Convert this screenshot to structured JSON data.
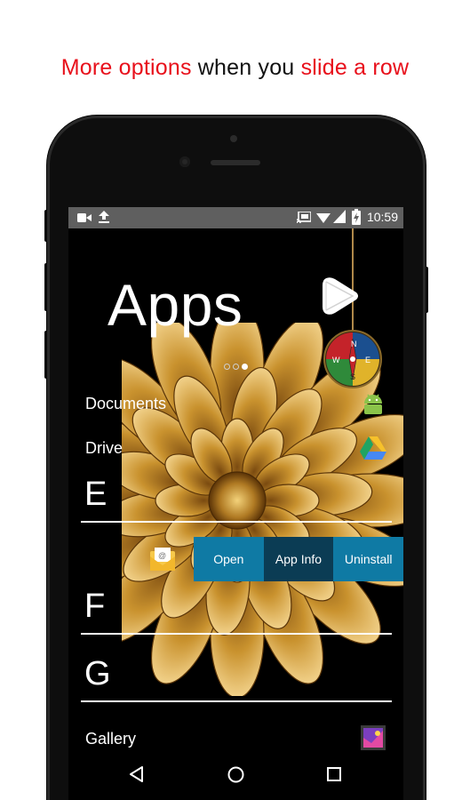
{
  "headline": {
    "part1": "More options",
    "part2": " when you ",
    "part3": "slide a row"
  },
  "statusbar": {
    "time": "10:59"
  },
  "screen": {
    "title": "Apps",
    "page_indicator": {
      "count": 3,
      "active": 3
    },
    "rows": {
      "documents": "Documents",
      "drive": "Drive",
      "gallery": "Gallery"
    },
    "sections": {
      "e": "E",
      "f": "F",
      "g": "G"
    },
    "swipe_actions": {
      "open": "Open",
      "app_info": "App Info",
      "uninstall": "Uninstall"
    },
    "compass": {
      "n": "N",
      "e": "E",
      "s": "S",
      "w": "W"
    }
  },
  "colors": {
    "accent": "#e8101b",
    "action_primary": "#0f7aa4",
    "action_selected": "#0b3c54"
  }
}
